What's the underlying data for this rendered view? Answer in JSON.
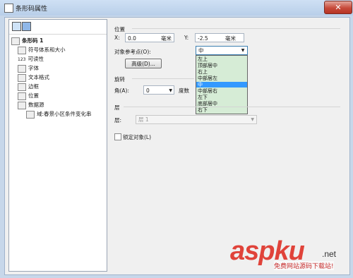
{
  "window": {
    "title": "条形码属性",
    "close_glyph": "✕"
  },
  "tree": {
    "items": [
      {
        "label": "条形码 1",
        "icon": "barcode-icon"
      },
      {
        "label": "符号体系和大小",
        "icon": "barcode-icon"
      },
      {
        "label": "可读性",
        "icon": "123-icon",
        "prefix": "123"
      },
      {
        "label": "字体",
        "icon": "font-icon"
      },
      {
        "label": "文本格式",
        "icon": "text-format-icon"
      },
      {
        "label": "边框",
        "icon": "border-icon"
      },
      {
        "label": "位置",
        "icon": "position-icon"
      },
      {
        "label": "数据源",
        "icon": "datasource-icon"
      },
      {
        "label": "域:春景小区条件变化串",
        "icon": "database-icon"
      }
    ]
  },
  "position": {
    "section_label": "位置",
    "x_label": "X:",
    "x_value": "0.0",
    "x_unit": "毫米",
    "y_label": "Y:",
    "y_value": "-2.5",
    "y_unit": "毫米",
    "ref_point_label": "对象参考点(O):",
    "ref_point_value": "中",
    "advanced_button": "高级(D)...",
    "ref_point_options": [
      "左上",
      "顶部居中",
      "右上",
      "中部居左",
      "中",
      "中部居右",
      "左下",
      "底部居中",
      "右下"
    ],
    "selected_index": 4
  },
  "rotation": {
    "section_label": "旋转",
    "angle_label": "角(A):",
    "angle_value": "0",
    "unit": "度数"
  },
  "layer": {
    "section_label": "层",
    "layer_label": "层:",
    "layer_value": "层 1"
  },
  "lock": {
    "label": "锁定对象(L)"
  },
  "watermark": {
    "main": "aspku",
    "sub": "免费网站源码下载站!",
    "net": ".net"
  }
}
